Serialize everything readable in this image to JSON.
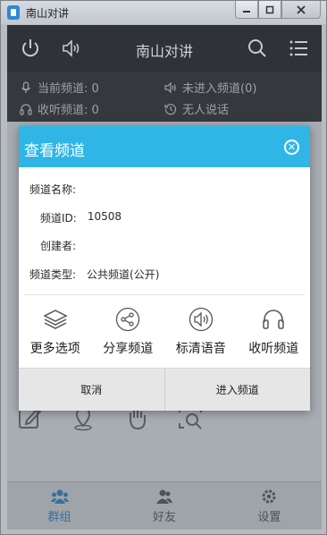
{
  "window": {
    "title": "南山对讲",
    "controls": [
      "minimize",
      "maximize",
      "close"
    ]
  },
  "header": {
    "title": "南山对讲",
    "icons": [
      "power-icon",
      "speaker-icon",
      "search-icon",
      "list-icon"
    ]
  },
  "status": {
    "current_channel": "当前频道: 0",
    "not_joined": "未进入频道(0)",
    "listening": "收听频道: 0",
    "speaking": "无人说话"
  },
  "dialog": {
    "title": "查看频道",
    "fields": {
      "name_label": "频道名称:",
      "name_value": "",
      "id_label": "频道ID:",
      "id_value": "10508",
      "creator_label": "创建者:",
      "creator_value": "",
      "type_label": "频道类型:",
      "type_value": "公共频道(公开)"
    },
    "actions": [
      {
        "label": "更多选项",
        "icon": "layers-icon"
      },
      {
        "label": "分享频道",
        "icon": "share-icon"
      },
      {
        "label": "标清语音",
        "icon": "speaker-icon"
      },
      {
        "label": "收听频道",
        "icon": "headphones-icon"
      }
    ],
    "cancel_label": "取消",
    "enter_label": "进入频道"
  },
  "bottom_nav": {
    "items": [
      {
        "label": "群组",
        "icon": "group-icon",
        "active": true
      },
      {
        "label": "好友",
        "icon": "friends-icon",
        "active": false
      },
      {
        "label": "设置",
        "icon": "gear-icon",
        "active": false
      }
    ]
  },
  "colors": {
    "dialog_header": "#2fb6e6",
    "app_header": "#2f3237",
    "footer_bg": "#e6e6e6"
  }
}
